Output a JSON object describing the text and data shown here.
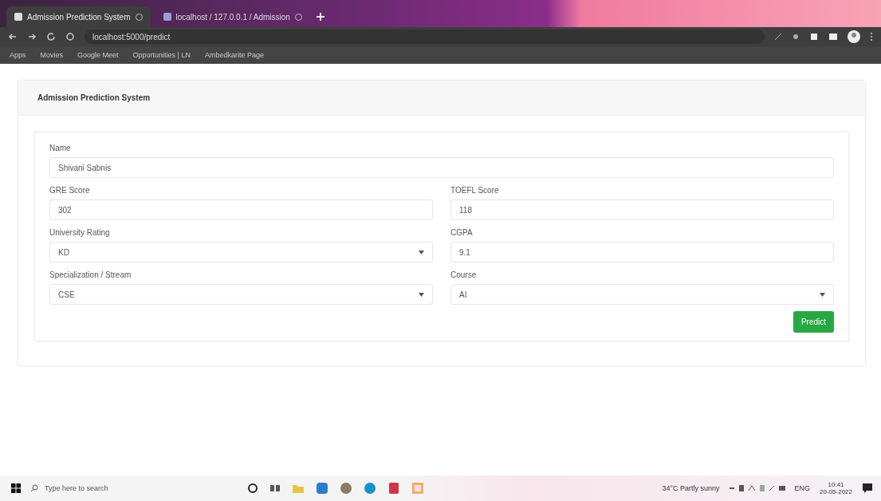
{
  "browser": {
    "tabs": [
      {
        "title": "Admission Prediction System",
        "selected": true
      },
      {
        "title": "localhost / 127.0.0.1 / Admission",
        "selected": false
      }
    ],
    "address": "localhost:5000/predict",
    "bookmarks": [
      "Apps",
      "Movies",
      "Google Meet",
      "Opportunities | LN",
      "Ambedkarite Page"
    ]
  },
  "card": {
    "title": "Admission Prediction System"
  },
  "name_field": {
    "label": "Name",
    "value": "Shivani Sabnis",
    "kind": "text"
  },
  "fields": [
    {
      "label": "GRE Score",
      "value": "302",
      "kind": "text"
    },
    {
      "label": "TOEFL Score",
      "value": "118",
      "kind": "text"
    },
    {
      "label": "University Rating",
      "value": "KD",
      "kind": "select"
    },
    {
      "label": "CGPA",
      "value": "9.1",
      "kind": "text"
    },
    {
      "label": "Specialization / Stream",
      "value": "CSE",
      "kind": "select"
    },
    {
      "label": "Course",
      "value": "AI",
      "kind": "select"
    }
  ],
  "submit": "Predict",
  "taskbar": {
    "search_placeholder": "Type here to search",
    "weather": "34°C Partly sunny",
    "language": "ENG",
    "time": "10:41",
    "date": "20-05-2022"
  }
}
